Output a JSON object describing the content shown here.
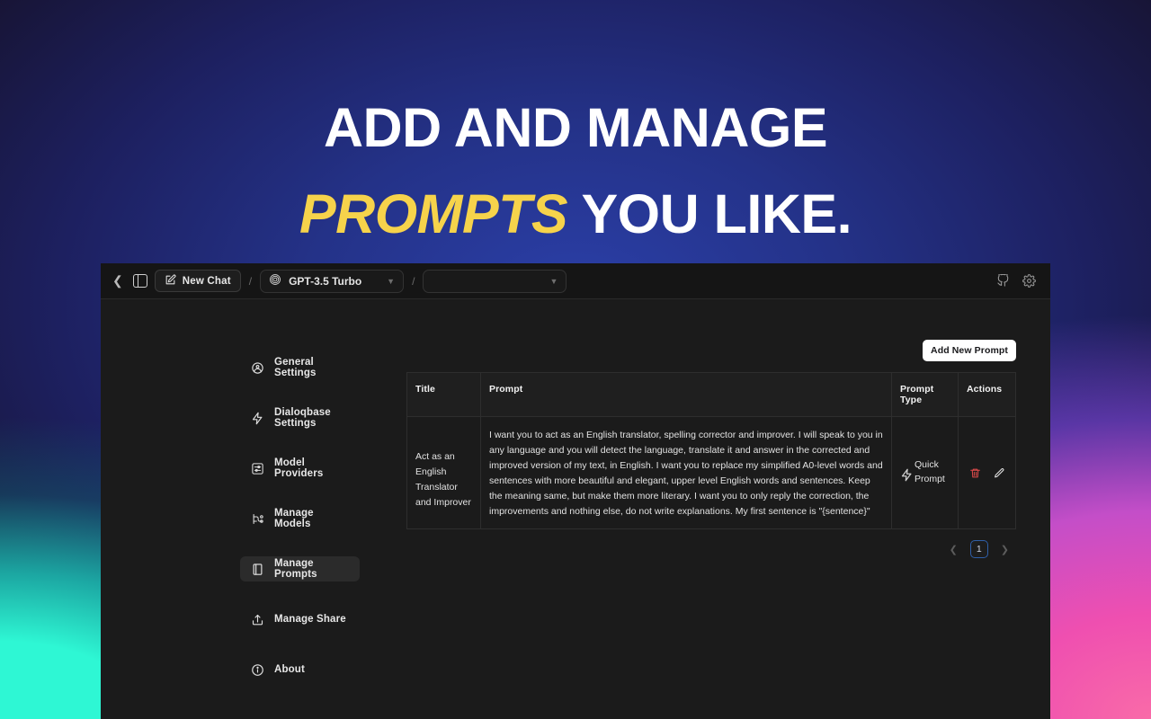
{
  "hero": {
    "line1": "ADD AND MANAGE",
    "line2_highlight": "PROMPTS",
    "line2_rest": "YOU LIKE.",
    "highlight_color": "#f6d34b"
  },
  "topbar": {
    "back_icon": "chevron-left-icon",
    "panel_toggle_icon": "sidebar-toggle-icon",
    "new_chat_label": "New Chat",
    "new_chat_icon": "edit-square-icon",
    "separator": "/",
    "model_icon": "openai-logo-icon",
    "model_label": "GPT-3.5 Turbo",
    "secondary_select_value": "",
    "chevron_icon": "chevron-down-icon",
    "github_icon": "github-icon",
    "settings_icon": "gear-icon"
  },
  "sidebar": {
    "items": [
      {
        "label": "General Settings",
        "icon": "settings-gear-icon",
        "active": false
      },
      {
        "label": "Dialoqbase Settings",
        "icon": "lightning-bolt-icon",
        "active": false
      },
      {
        "label": "Model Providers",
        "icon": "sliders-box-icon",
        "active": false
      },
      {
        "label": "Manage Models",
        "icon": "model-node-icon",
        "active": false
      },
      {
        "label": "Manage Prompts",
        "icon": "book-icon",
        "active": true
      },
      {
        "label": "Manage Share",
        "icon": "share-upload-icon",
        "active": false
      },
      {
        "label": "About",
        "icon": "info-circle-icon",
        "active": false
      }
    ]
  },
  "main": {
    "add_button_label": "Add New Prompt",
    "table": {
      "headers": [
        "Title",
        "Prompt",
        "Prompt Type",
        "Actions"
      ],
      "rows": [
        {
          "title": "Act as an English Translator and Improver",
          "prompt": "I want you to act as an English translator, spelling corrector and improver. I will speak to you in any language and you will detect the language, translate it and answer in the corrected and improved version of my text, in English. I want you to replace my simplified A0-level words and sentences with more beautiful and elegant, upper level English words and sentences. Keep the meaning same, but make them more literary. I want you to only reply the correction, the improvements and nothing else, do not write explanations. My first sentence is \"{sentence}\"",
          "prompt_type": "Quick Prompt",
          "prompt_type_icon": "lightning-bolt-icon",
          "actions": {
            "delete_icon": "trash-icon",
            "delete_color": "#e04b4b",
            "edit_icon": "pencil-icon",
            "edit_color": "#e6e6e6"
          }
        }
      ]
    },
    "pagination": {
      "prev_icon": "chevron-left-icon",
      "next_icon": "chevron-right-icon",
      "current_page": "1",
      "accent_color": "#2f5fa8"
    }
  }
}
